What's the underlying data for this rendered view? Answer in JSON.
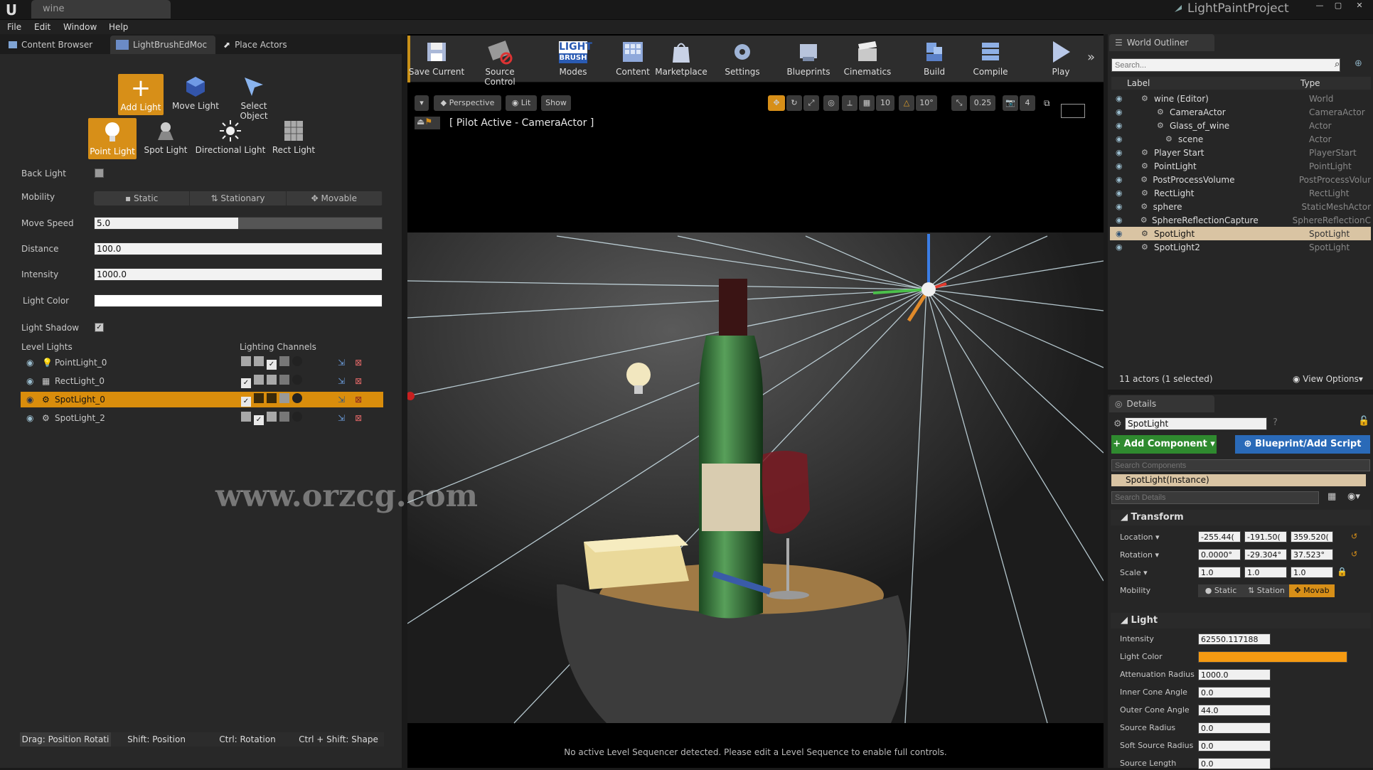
{
  "window": {
    "tab": "wine",
    "project": "LightPaintProject",
    "minimize": "—",
    "maximize": "▢",
    "close": "✕"
  },
  "menu": [
    "File",
    "Edit",
    "Window",
    "Help"
  ],
  "left_tabs": [
    "Content Browser",
    "LightBrushEdMoc",
    "Place Actors"
  ],
  "tools_row1": [
    "Add Light",
    "Move Light",
    "Select Object"
  ],
  "tools_row2": [
    "Point Light",
    "Spot Light",
    "Directional Light",
    "Rect Light"
  ],
  "props": {
    "back_light": "Back Light",
    "mobility": "Mobility",
    "mobility_options": [
      "Static",
      "Stationary",
      "Movable"
    ],
    "move_speed_label": "Move Speed",
    "move_speed": "5.0",
    "move_speed_fill": 0.5,
    "distance_label": "Distance",
    "distance": "100.0",
    "intensity_label": "Intensity",
    "intensity": "1000.0",
    "light_color_label": "Light Color",
    "light_shadow_label": "Light Shadow",
    "level_lights_label": "Level Lights",
    "lighting_channels_label": "Lighting Channels"
  },
  "level_lights": [
    {
      "name": "PointLight_0",
      "selected": false
    },
    {
      "name": "RectLight_0",
      "selected": false
    },
    {
      "name": "SpotLight_0",
      "selected": true
    },
    {
      "name": "SpotLight_2",
      "selected": false
    }
  ],
  "statusbar": [
    "Drag: Position Rotati",
    "Shift: Position",
    "Ctrl: Rotation",
    "Ctrl + Shift: Shape"
  ],
  "toolbar": [
    "Save Current",
    "Source Control",
    "Modes",
    "Content",
    "Marketplace",
    "Settings",
    "Blueprints",
    "Cinematics",
    "Build",
    "Compile",
    "Play"
  ],
  "modes_icon_text": [
    "LIGHT",
    "BRUSH"
  ],
  "viewport": {
    "perspective": "Perspective",
    "lit": "Lit",
    "show": "Show",
    "pilot": "[ Pilot Active - CameraActor ]",
    "snap_values": [
      "10",
      "10°",
      "0.25",
      "4"
    ],
    "watermark": "www.orzcg.com",
    "footer": "No active Level Sequencer detected. Please edit a Level Sequence to enable full controls."
  },
  "outliner": {
    "title": "World Outliner",
    "search_placeholder": "Search...",
    "col_label": "Label",
    "col_type": "Type",
    "rows": [
      {
        "label": "wine (Editor)",
        "type": "World",
        "selected": false
      },
      {
        "label": "CameraActor",
        "type": "CameraActor",
        "selected": false
      },
      {
        "label": "Glass_of_wine",
        "type": "Actor",
        "selected": false
      },
      {
        "label": "scene",
        "type": "Actor",
        "selected": false
      },
      {
        "label": "Player Start",
        "type": "PlayerStart",
        "selected": false
      },
      {
        "label": "PointLight",
        "type": "PointLight",
        "selected": false
      },
      {
        "label": "PostProcessVolume",
        "type": "PostProcessVolur",
        "selected": false
      },
      {
        "label": "RectLight",
        "type": "RectLight",
        "selected": false
      },
      {
        "label": "sphere",
        "type": "StaticMeshActor",
        "selected": false
      },
      {
        "label": "SphereReflectionCapture",
        "type": "SphereReflectionC",
        "selected": false
      },
      {
        "label": "SpotLight",
        "type": "SpotLight",
        "selected": true
      },
      {
        "label": "SpotLight2",
        "type": "SpotLight",
        "selected": false
      }
    ],
    "footer": "11 actors (1 selected)",
    "view_options": "View Options"
  },
  "details": {
    "title": "Details",
    "name": "SpotLight",
    "add_component": "+ Add Component",
    "blueprint": "Blueprint/Add Script",
    "search_components": "Search Components",
    "instance": "SpotLight(Instance)",
    "search_details": "Search Details",
    "transform": "Transform",
    "location_label": "Location",
    "location": [
      "-255.44(",
      "-191.50(",
      "359.520("
    ],
    "rotation_label": "Rotation",
    "rotation": [
      "0.0000°",
      "-29.304°",
      "37.523°"
    ],
    "scale_label": "Scale",
    "scale": [
      "1.0",
      "1.0",
      "1.0"
    ],
    "mobility_label": "Mobility",
    "mobility": [
      "Static",
      "Station",
      "Movab"
    ],
    "light": "Light",
    "light_props": [
      {
        "label": "Intensity",
        "value": "62550.117188"
      },
      {
        "label": "Light Color",
        "value": ""
      },
      {
        "label": "Attenuation Radius",
        "value": "1000.0"
      },
      {
        "label": "Inner Cone Angle",
        "value": "0.0"
      },
      {
        "label": "Outer Cone Angle",
        "value": "44.0"
      },
      {
        "label": "Source Radius",
        "value": "0.0"
      },
      {
        "label": "Soft Source Radius",
        "value": "0.0"
      },
      {
        "label": "Source Length",
        "value": "0.0"
      }
    ],
    "light_color": "#f59a12"
  }
}
